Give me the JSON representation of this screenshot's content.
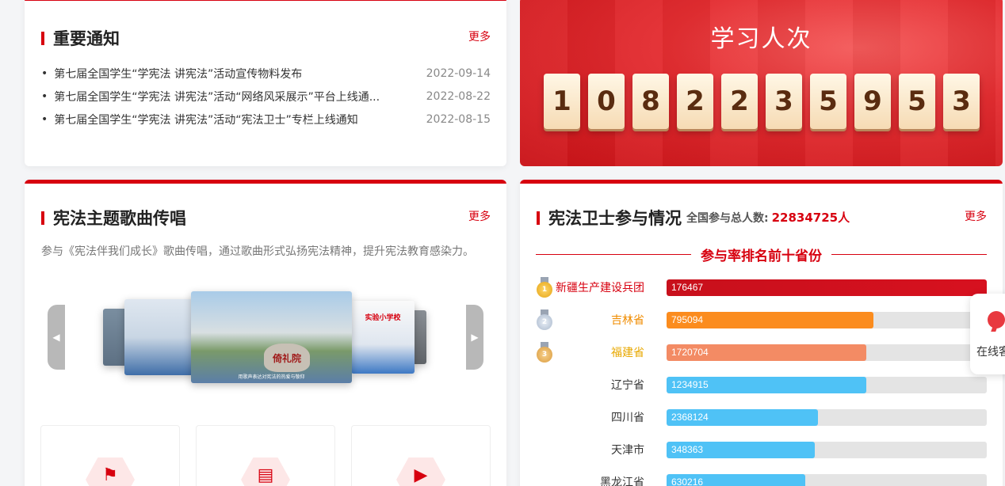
{
  "notice": {
    "title": "重要通知",
    "more": "更多",
    "items": [
      {
        "title": "第七届全国学生“学宪法 讲宪法”活动宣传物料发布",
        "date": "2022-09-14"
      },
      {
        "title": "第七届全国学生“学宪法 讲宪法”活动“网络风采展示”平台上线通...",
        "date": "2022-08-22"
      },
      {
        "title": "第七届全国学生“学宪法 讲宪法”活动“宪法卫士”专栏上线通知",
        "date": "2022-08-15"
      }
    ]
  },
  "counter": {
    "title": "学习人次",
    "digits": [
      "1",
      "0",
      "8",
      "2",
      "2",
      "3",
      "5",
      "9",
      "5",
      "3"
    ]
  },
  "song": {
    "title": "宪法主题歌曲传唱",
    "more": "更多",
    "desc": "参与《宪法伴我们成长》歌曲传唱，通过歌曲形式弘扬宪法精神，提升宪法教育感染力。",
    "stone_text": "倚礼院",
    "school_sign": "实验小学校",
    "caption": "用歌声表达对宪法的热爱与敬仰"
  },
  "guard": {
    "title": "宪法卫士参与情况",
    "more": "更多",
    "total_label": "全国参与总人数:",
    "total_value": "22834725人",
    "subtitle": "参与率排名前十省份",
    "colors": {
      "red": "#d7111f",
      "orange": "#fb8c1e",
      "salmon": "#f38b64",
      "blue": "#4fc2f6"
    },
    "ranks": [
      {
        "name": "新疆生产建设兵团",
        "value": "176467",
        "pct": 100,
        "color": "red",
        "medal": "1",
        "nameColor": "#d7000f"
      },
      {
        "name": "吉林省",
        "value": "795094",
        "pct": 64.5,
        "color": "orange",
        "medal": "2",
        "nameColor": "#f08c00"
      },
      {
        "name": "福建省",
        "value": "1720704",
        "pct": 62.4,
        "color": "salmon",
        "medal": "3",
        "nameColor": "#e8a800"
      },
      {
        "name": "辽宁省",
        "value": "1234915",
        "pct": 62.4,
        "color": "blue",
        "medal": "",
        "nameColor": "#333333"
      },
      {
        "name": "四川省",
        "value": "2368124",
        "pct": 47.3,
        "color": "blue",
        "medal": "",
        "nameColor": "#333333"
      },
      {
        "name": "天津市",
        "value": "348363",
        "pct": 46.3,
        "color": "blue",
        "medal": "",
        "nameColor": "#333333"
      },
      {
        "name": "黑龙江省",
        "value": "630216",
        "pct": 43.3,
        "color": "blue",
        "medal": "",
        "nameColor": "#333333"
      }
    ]
  },
  "service": {
    "label": "在线客服"
  }
}
